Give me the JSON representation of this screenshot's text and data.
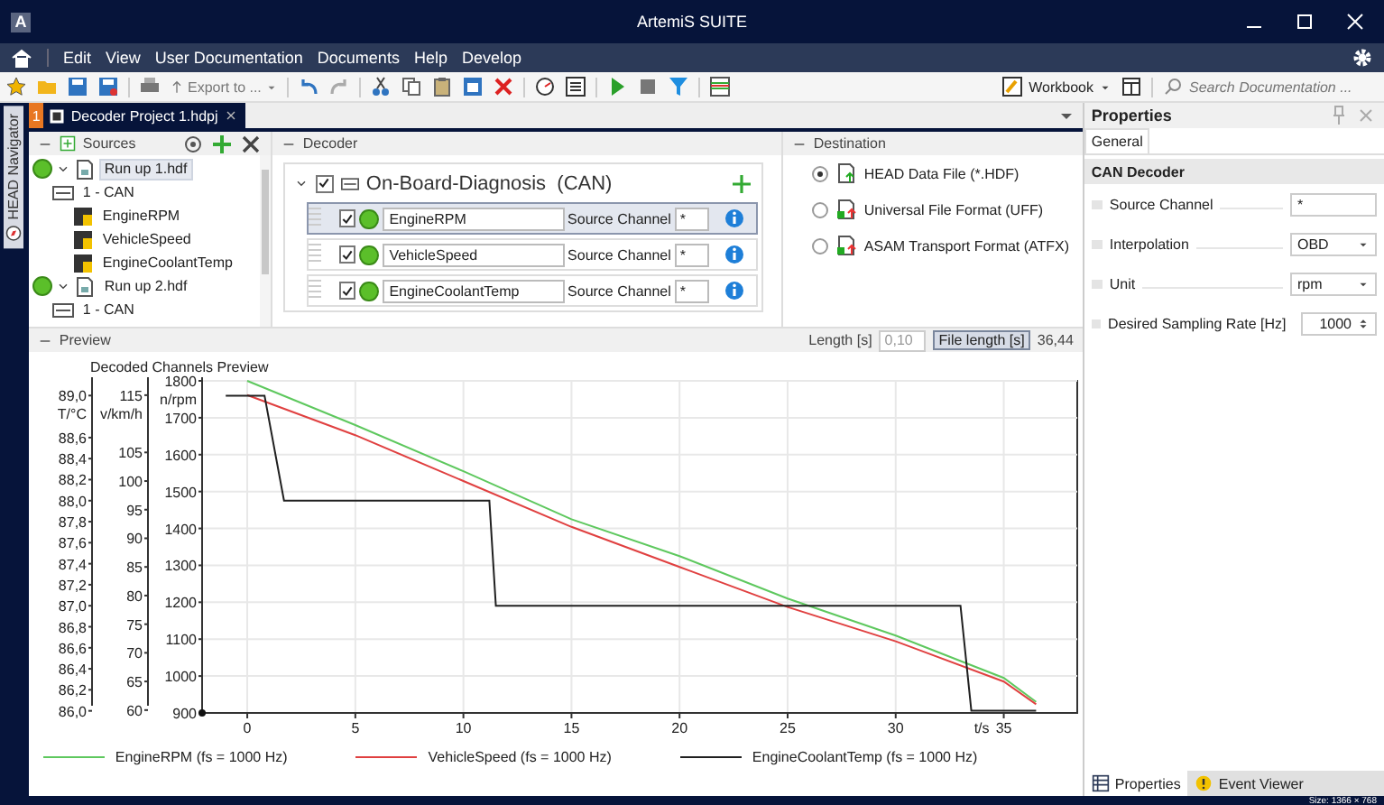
{
  "window": {
    "logo": "A",
    "title": "ArtemiS SUITE"
  },
  "menu": [
    "Edit",
    "View",
    "User Documentation",
    "Documents",
    "Help",
    "Develop"
  ],
  "toolbar": {
    "export": "Export to ...",
    "workbook": "Workbook",
    "search": {
      "placeholder": "Search Documentation ..."
    }
  },
  "navigator": {
    "label": "HEAD Navigator"
  },
  "document_tab": {
    "number": "1",
    "title": "Decoder Project 1.hdpj",
    "selected": true
  },
  "sources": {
    "title": "Sources",
    "tree": [
      {
        "label": "Run up 1.hdf",
        "kind": "file",
        "expanded": true,
        "selected": true,
        "children": [
          {
            "label": "1 - CAN",
            "kind": "bus",
            "children": [
              {
                "label": "EngineRPM",
                "kind": "channel"
              },
              {
                "label": "VehicleSpeed",
                "kind": "channel"
              },
              {
                "label": "EngineCoolantTemp",
                "kind": "channel"
              }
            ]
          }
        ]
      },
      {
        "label": "Run up 2.hdf",
        "kind": "file",
        "expanded": true,
        "selected": false,
        "children": [
          {
            "label": "1 - CAN",
            "kind": "bus"
          }
        ]
      }
    ]
  },
  "decoder": {
    "title": "Decoder",
    "group": {
      "label": "On-Board-Diagnosis  (CAN)",
      "checked": true,
      "expanded": true
    },
    "channels": [
      {
        "name": "EngineRPM",
        "checked": true,
        "selected": true,
        "source_label": "Source Channel",
        "source_value": "*"
      },
      {
        "name": "VehicleSpeed",
        "checked": true,
        "selected": false,
        "source_label": "Source Channel",
        "source_value": "*"
      },
      {
        "name": "EngineCoolantTemp",
        "checked": true,
        "selected": false,
        "source_label": "Source Channel",
        "source_value": "*"
      }
    ]
  },
  "destination": {
    "title": "Destination",
    "options": [
      {
        "label": "HEAD Data File (*.HDF)",
        "selected": true
      },
      {
        "label": "Universal File Format (UFF)",
        "selected": false
      },
      {
        "label": "ASAM Transport Format (ATFX)",
        "selected": false
      }
    ]
  },
  "preview": {
    "title": "Preview",
    "length_label": "Length [s]",
    "length_value": "0,10",
    "file_length_button": "File length [s]",
    "file_length_value": "36,44",
    "chart_data": {
      "type": "line",
      "grid": true,
      "title": "Decoded Channels Preview",
      "xlabel": "t/s",
      "xlim": [
        -2.09,
        38.4
      ],
      "xticks": [
        0,
        5,
        10,
        15,
        20,
        25,
        30,
        35
      ],
      "ylabel": "n/rpm",
      "ylim": [
        900,
        1800
      ],
      "yticks": [
        900,
        1000,
        1100,
        1200,
        1300,
        1400,
        1500,
        1600,
        1700,
        1800
      ],
      "y2label": "v/km/h",
      "y2lim": [
        59.5,
        117.5
      ],
      "y2ticks": [
        {
          "value": 60,
          "label": "60"
        },
        {
          "value": 65,
          "label": "65"
        },
        {
          "value": 70,
          "label": "70"
        },
        {
          "value": 75,
          "label": "75"
        },
        {
          "value": 80,
          "label": "80"
        },
        {
          "value": 85,
          "label": "85"
        },
        {
          "value": 90,
          "label": "90"
        },
        {
          "value": 95,
          "label": "95"
        },
        {
          "value": 100,
          "label": "100"
        },
        {
          "value": 105,
          "label": "105"
        },
        {
          "value": 115,
          "label": "115"
        }
      ],
      "y3label": "T/°C",
      "y3lim": [
        85.98,
        89.14
      ],
      "y3ticks": [
        {
          "value": 86,
          "label": "86,0"
        },
        {
          "value": 86.2,
          "label": "86,2"
        },
        {
          "value": 86.4,
          "label": "86,4"
        },
        {
          "value": 86.6,
          "label": "86,6"
        },
        {
          "value": 86.8,
          "label": "86,8"
        },
        {
          "value": 87,
          "label": "87,0"
        },
        {
          "value": 87.2,
          "label": "87,2"
        },
        {
          "value": 87.4,
          "label": "87,4"
        },
        {
          "value": 87.6,
          "label": "87,6"
        },
        {
          "value": 87.8,
          "label": "87,8"
        },
        {
          "value": 88,
          "label": "88,0"
        },
        {
          "value": 88.2,
          "label": "88,2"
        },
        {
          "value": 88.4,
          "label": "88,4"
        },
        {
          "value": 88.6,
          "label": "88,6"
        },
        {
          "value": 89,
          "label": "89,0"
        }
      ],
      "series": [
        {
          "name": "EngineRPM (fs = 1000 Hz)",
          "color": "#5ec85e",
          "x": [
            0,
            5,
            10,
            15,
            20,
            25,
            30,
            35,
            36.5
          ],
          "values": [
            1800,
            1680,
            1555,
            1425,
            1325,
            1210,
            1110,
            995,
            930
          ]
        },
        {
          "name": "VehicleSpeed (fs = 1000 Hz)",
          "color": "#e04040",
          "axis": "y2",
          "x": [
            0,
            5,
            10,
            15,
            20,
            25,
            30,
            35,
            36.5
          ],
          "values": [
            115,
            108,
            100,
            92,
            85,
            78,
            72,
            65,
            61
          ]
        },
        {
          "name": "EngineCoolantTemp (fs = 1000 Hz)",
          "color": "#202020",
          "axis": "y3",
          "x": [
            -1,
            0.8,
            1.7,
            11.2,
            11.5,
            33,
            33.5,
            36.5
          ],
          "values": [
            89,
            89,
            88,
            88,
            87,
            87,
            86,
            86
          ]
        }
      ]
    }
  },
  "properties": {
    "title": "Properties",
    "tab": "General",
    "section": "CAN Decoder",
    "rows": [
      {
        "label": "Source Channel",
        "kind": "text",
        "value": "*"
      },
      {
        "label": "Interpolation",
        "kind": "dropdown",
        "value": "OBD"
      },
      {
        "label": "Unit",
        "kind": "dropdown",
        "value": "rpm"
      },
      {
        "label": "Desired Sampling Rate [Hz]",
        "kind": "spinner",
        "value": "1000"
      }
    ],
    "bottom_tabs": [
      {
        "label": "Properties",
        "selected": true
      },
      {
        "label": "Event Viewer",
        "selected": false
      }
    ]
  },
  "status_bar": "Size: 1366 × 768"
}
